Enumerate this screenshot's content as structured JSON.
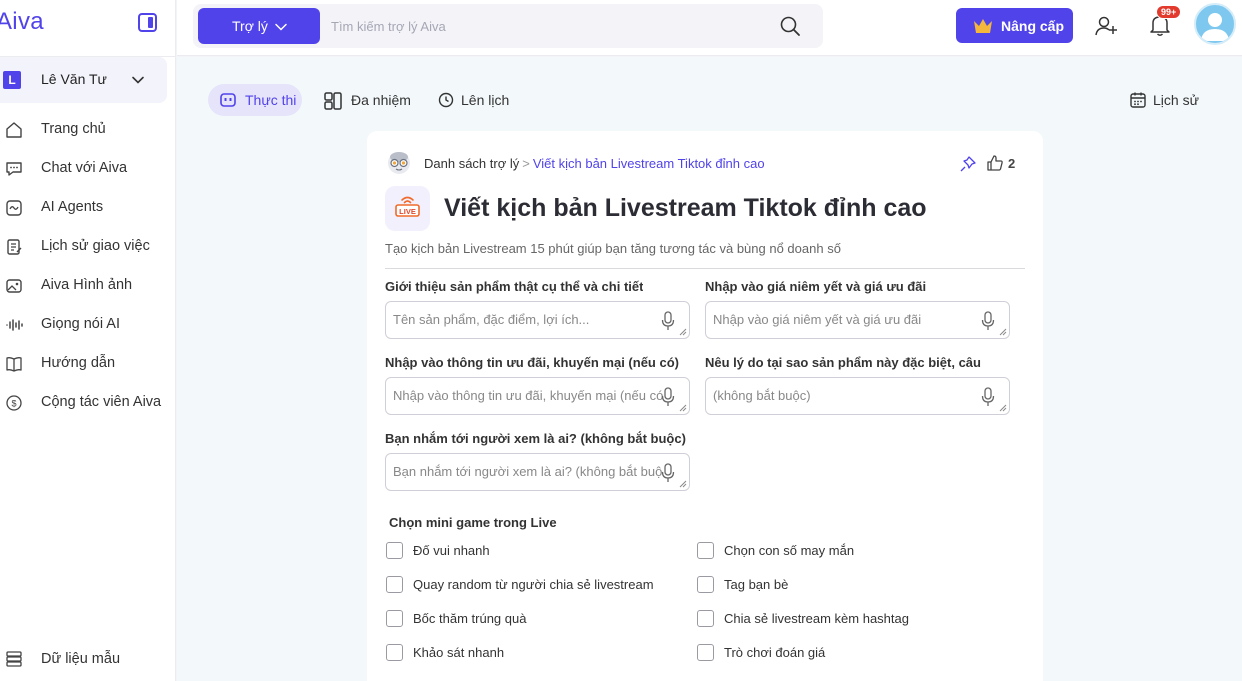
{
  "brand": {
    "name": "Aiva"
  },
  "user": {
    "initial": "L",
    "name": "Lê Văn Tư"
  },
  "sidebar": {
    "items": [
      {
        "label": "Trang chủ",
        "icon": "home-icon"
      },
      {
        "label": "Chat với Aiva",
        "icon": "chat-icon"
      },
      {
        "label": "AI Agents",
        "icon": "agents-icon"
      },
      {
        "label": "Lịch sử giao việc",
        "icon": "task-history-icon"
      },
      {
        "label": "Aiva Hình ảnh",
        "icon": "image-icon"
      },
      {
        "label": "Giọng nói AI",
        "icon": "voice-icon"
      },
      {
        "label": "Hướng dẫn",
        "icon": "book-icon"
      },
      {
        "label": "Cộng tác viên Aiva",
        "icon": "dollar-icon"
      }
    ],
    "bottom": {
      "label": "Dữ liệu mẫu",
      "icon": "database-icon"
    }
  },
  "topbar": {
    "assistant_button": "Trợ lý",
    "search_placeholder": "Tìm kiếm trợ lý Aiva",
    "upgrade_button": "Nâng cấp",
    "notification_badge": "99+"
  },
  "tabs": [
    {
      "label": "Thực thi",
      "active": true
    },
    {
      "label": "Đa nhiệm",
      "active": false
    },
    {
      "label": "Lên lịch",
      "active": false
    }
  ],
  "history_label": "Lịch sử",
  "breadcrumb": {
    "parent": "Danh sách trợ lý",
    "separator": ">",
    "current": "Viết kịch bản Livestream Tiktok đỉnh cao"
  },
  "like_count": "2",
  "title_icon_text": "LIVE",
  "title": "Viết kịch bản Livestream Tiktok đỉnh cao",
  "description": "Tạo kịch bản Livestream 15 phút giúp bạn tăng tương tác và bùng nổ doanh số",
  "fields": [
    {
      "label": "Giới thiệu sản phẩm thật cụ thể và chi tiết",
      "placeholder": "Tên sản phẩm, đặc điểm, lợi ích..."
    },
    {
      "label": "Nhập vào giá niêm yết và giá ưu đãi",
      "placeholder": "Nhập vào giá niêm yết và giá ưu đãi"
    },
    {
      "label": "Nhập vào thông tin ưu đãi, khuyến mại (nếu có)",
      "placeholder": "Nhập vào thông tin ưu đãi, khuyến mại (nếu có)"
    },
    {
      "label": "Nêu lý do tại sao sản phẩm này đặc biệt, câu",
      "placeholder": "(không bắt buộc)"
    },
    {
      "label": "Bạn nhắm tới người xem là ai? (không bắt buộc)",
      "placeholder": "Bạn nhắm tới người xem là ai? (không bắt buộc)"
    }
  ],
  "mini_game": {
    "title": "Chọn mini game trong Live",
    "options": [
      "Đố vui nhanh",
      "Chọn con số may mắn",
      "Quay random từ người chia sẻ livestream",
      "Tag bạn bè",
      "Bốc thăm trúng quà",
      "Chia sẻ livestream kèm hashtag",
      "Khảo sát nhanh",
      "Trò chơi đoán giá"
    ]
  },
  "colors": {
    "accent": "#5143ea",
    "badge": "#e23b2e",
    "avatar": "#7ec8ef"
  }
}
